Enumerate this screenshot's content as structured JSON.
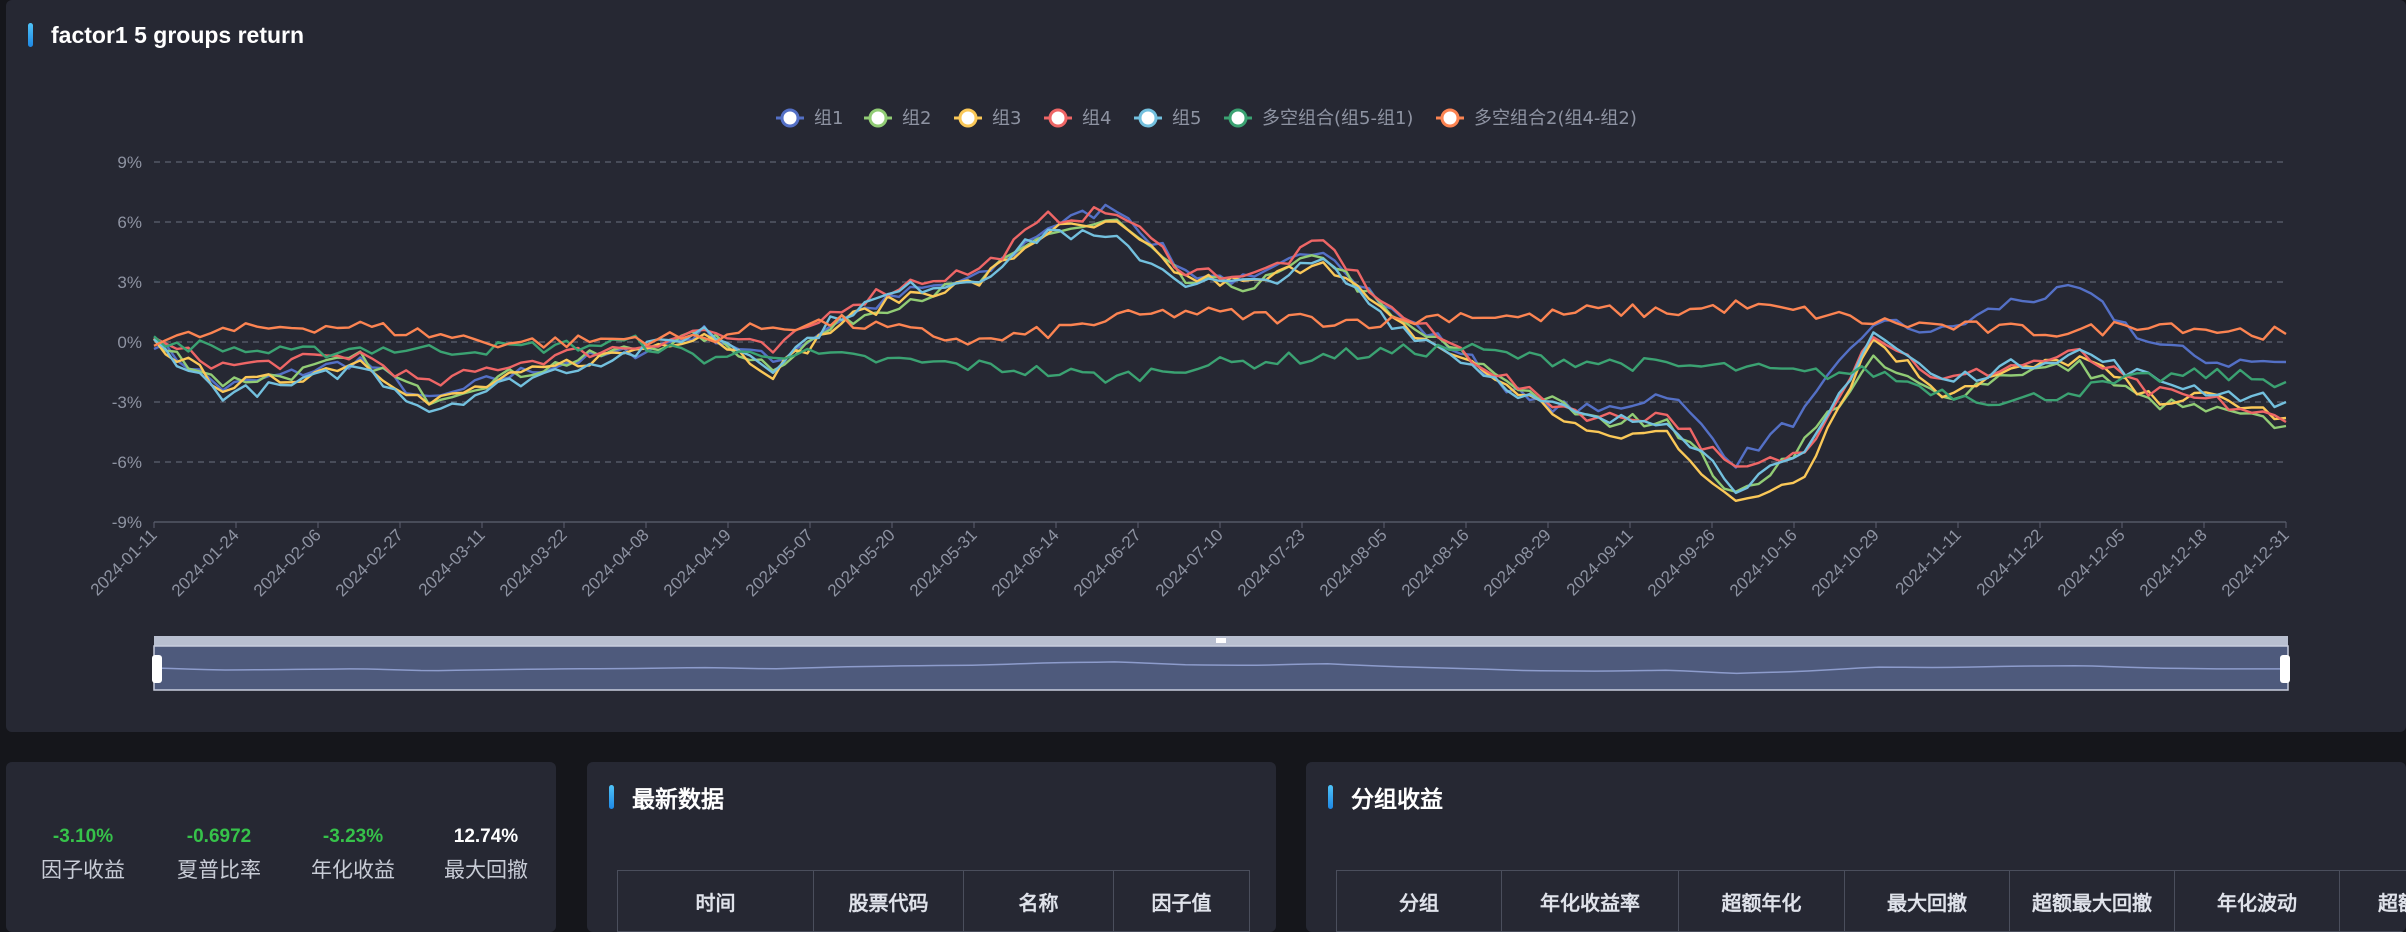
{
  "chart_panel": {
    "title": "factor1 5 groups return"
  },
  "chart_data": {
    "type": "line",
    "title": "factor1 5 groups return",
    "xlabel": "",
    "ylabel": "",
    "ylim": [
      -9,
      9
    ],
    "y_ticks": [
      9,
      6,
      3,
      0,
      -3,
      -6,
      -9
    ],
    "y_tick_labels": [
      "9%",
      "6%",
      "3%",
      "0%",
      "-3%",
      "-6%",
      "-9%"
    ],
    "x_tick_labels": [
      "2024-01-11",
      "2024-01-24",
      "2024-02-06",
      "2024-02-27",
      "2024-03-11",
      "2024-03-22",
      "2024-04-08",
      "2024-04-19",
      "2024-05-07",
      "2024-05-20",
      "2024-05-31",
      "2024-06-14",
      "2024-06-27",
      "2024-07-10",
      "2024-07-23",
      "2024-08-05",
      "2024-08-16",
      "2024-08-29",
      "2024-09-11",
      "2024-09-26",
      "2024-10-16",
      "2024-10-29",
      "2024-11-11",
      "2024-11-22",
      "2024-12-05",
      "2024-12-18",
      "2024-12-31"
    ],
    "grid": true,
    "legend_position": "top-center",
    "series": [
      {
        "name": "组1",
        "color": "#5470c6",
        "values": [
          0,
          -2.3,
          -1.6,
          -0.9,
          -3.0,
          -1.8,
          -1.0,
          -0.5,
          0.5,
          -1.0,
          1.2,
          2.5,
          3.2,
          5.8,
          6.8,
          3.5,
          3.0,
          4.8,
          1.5,
          -0.5,
          -3.0,
          -3.5,
          -2.5,
          -6.0,
          -3.5,
          1.0,
          0.5,
          2.0,
          2.6,
          0.0,
          -1.0,
          -1.0
        ]
      },
      {
        "name": "组2",
        "color": "#91cc75",
        "values": [
          0,
          -2.0,
          -1.6,
          -0.8,
          -2.8,
          -1.8,
          -1.0,
          -0.3,
          0.3,
          -1.2,
          1.0,
          2.2,
          3.0,
          5.5,
          6.0,
          3.0,
          2.8,
          4.4,
          1.2,
          -0.6,
          -2.5,
          -4.0,
          -3.8,
          -7.8,
          -5.0,
          -1.0,
          -2.8,
          -1.5,
          -1.2,
          -3.0,
          -3.5,
          -4.2
        ]
      },
      {
        "name": "组3",
        "color": "#fac858",
        "values": [
          0,
          -2.2,
          -1.8,
          -0.9,
          -3.1,
          -2.0,
          -1.1,
          -0.4,
          0.5,
          -1.5,
          1.0,
          2.4,
          3.0,
          5.6,
          5.8,
          3.2,
          2.9,
          4.2,
          1.0,
          -0.8,
          -2.8,
          -4.8,
          -4.5,
          -8.2,
          -6.5,
          0.2,
          -2.5,
          -1.5,
          -0.8,
          -2.8,
          -2.8,
          -3.8
        ]
      },
      {
        "name": "组4",
        "color": "#ee6666",
        "values": [
          0,
          -1.2,
          -1.0,
          -0.6,
          -2.2,
          -1.2,
          -0.6,
          -0.2,
          0.6,
          -0.5,
          1.8,
          3.0,
          3.6,
          6.2,
          6.5,
          3.6,
          3.3,
          5.0,
          1.6,
          -0.4,
          -2.6,
          -3.8,
          -3.6,
          -6.5,
          -5.5,
          0.5,
          -2.0,
          -1.2,
          -0.6,
          -2.5,
          -3.0,
          -4.0
        ]
      },
      {
        "name": "组5",
        "color": "#73c0de",
        "values": [
          0,
          -2.6,
          -2.2,
          -1.2,
          -3.4,
          -2.2,
          -1.3,
          -0.5,
          0.6,
          -1.2,
          1.4,
          2.7,
          3.2,
          5.6,
          5.0,
          3.0,
          2.9,
          4.0,
          1.0,
          -0.8,
          -2.8,
          -4.0,
          -3.8,
          -7.2,
          -5.8,
          0.5,
          -2.0,
          -1.2,
          -0.5,
          -1.8,
          -2.5,
          -3.0
        ]
      },
      {
        "name": "多空组合(组5-组1)",
        "color": "#3ba272",
        "values": [
          0,
          -0.3,
          -0.6,
          -0.3,
          -0.4,
          -0.3,
          -0.2,
          0,
          -0.8,
          -0.5,
          -0.8,
          -1.0,
          -1.2,
          -1.5,
          -1.8,
          -1.2,
          -1.0,
          -0.7,
          -0.5,
          -0.3,
          -0.8,
          -1.0,
          -1.2,
          -1.3,
          -1.6,
          -1.5,
          -2.5,
          -3.0,
          -2.4,
          -1.8,
          -1.6,
          -2.0
        ]
      },
      {
        "name": "多空组合2(组4-组2)",
        "color": "#fc8452",
        "values": [
          0,
          0.5,
          0.8,
          0.8,
          0.4,
          0,
          0,
          0.2,
          0.2,
          0.8,
          1.0,
          0.5,
          0,
          0.5,
          1.2,
          1.5,
          1.3,
          1.1,
          1.0,
          1.4,
          1.2,
          1.6,
          1.5,
          1.8,
          1.5,
          1.0,
          0.8,
          0.6,
          0.5,
          1.0,
          0.6,
          0.4
        ]
      }
    ]
  },
  "stats": [
    {
      "value": "-3.10%",
      "label": "因子收益",
      "color": "#36c24a"
    },
    {
      "value": "-0.6972",
      "label": "夏普比率",
      "color": "#36c24a"
    },
    {
      "value": "-3.23%",
      "label": "年化收益",
      "color": "#36c24a"
    },
    {
      "value": "12.74%",
      "label": "最大回撤",
      "color": "#ffffff"
    }
  ],
  "latest_data": {
    "title": "最新数据",
    "columns": [
      "时间",
      "股票代码",
      "名称",
      "因子值"
    ]
  },
  "group_returns": {
    "title": "分组收益",
    "columns": [
      "分组",
      "年化收益率",
      "超额年化",
      "最大回撤",
      "超额最大回撤",
      "年化波动",
      "超额"
    ]
  }
}
